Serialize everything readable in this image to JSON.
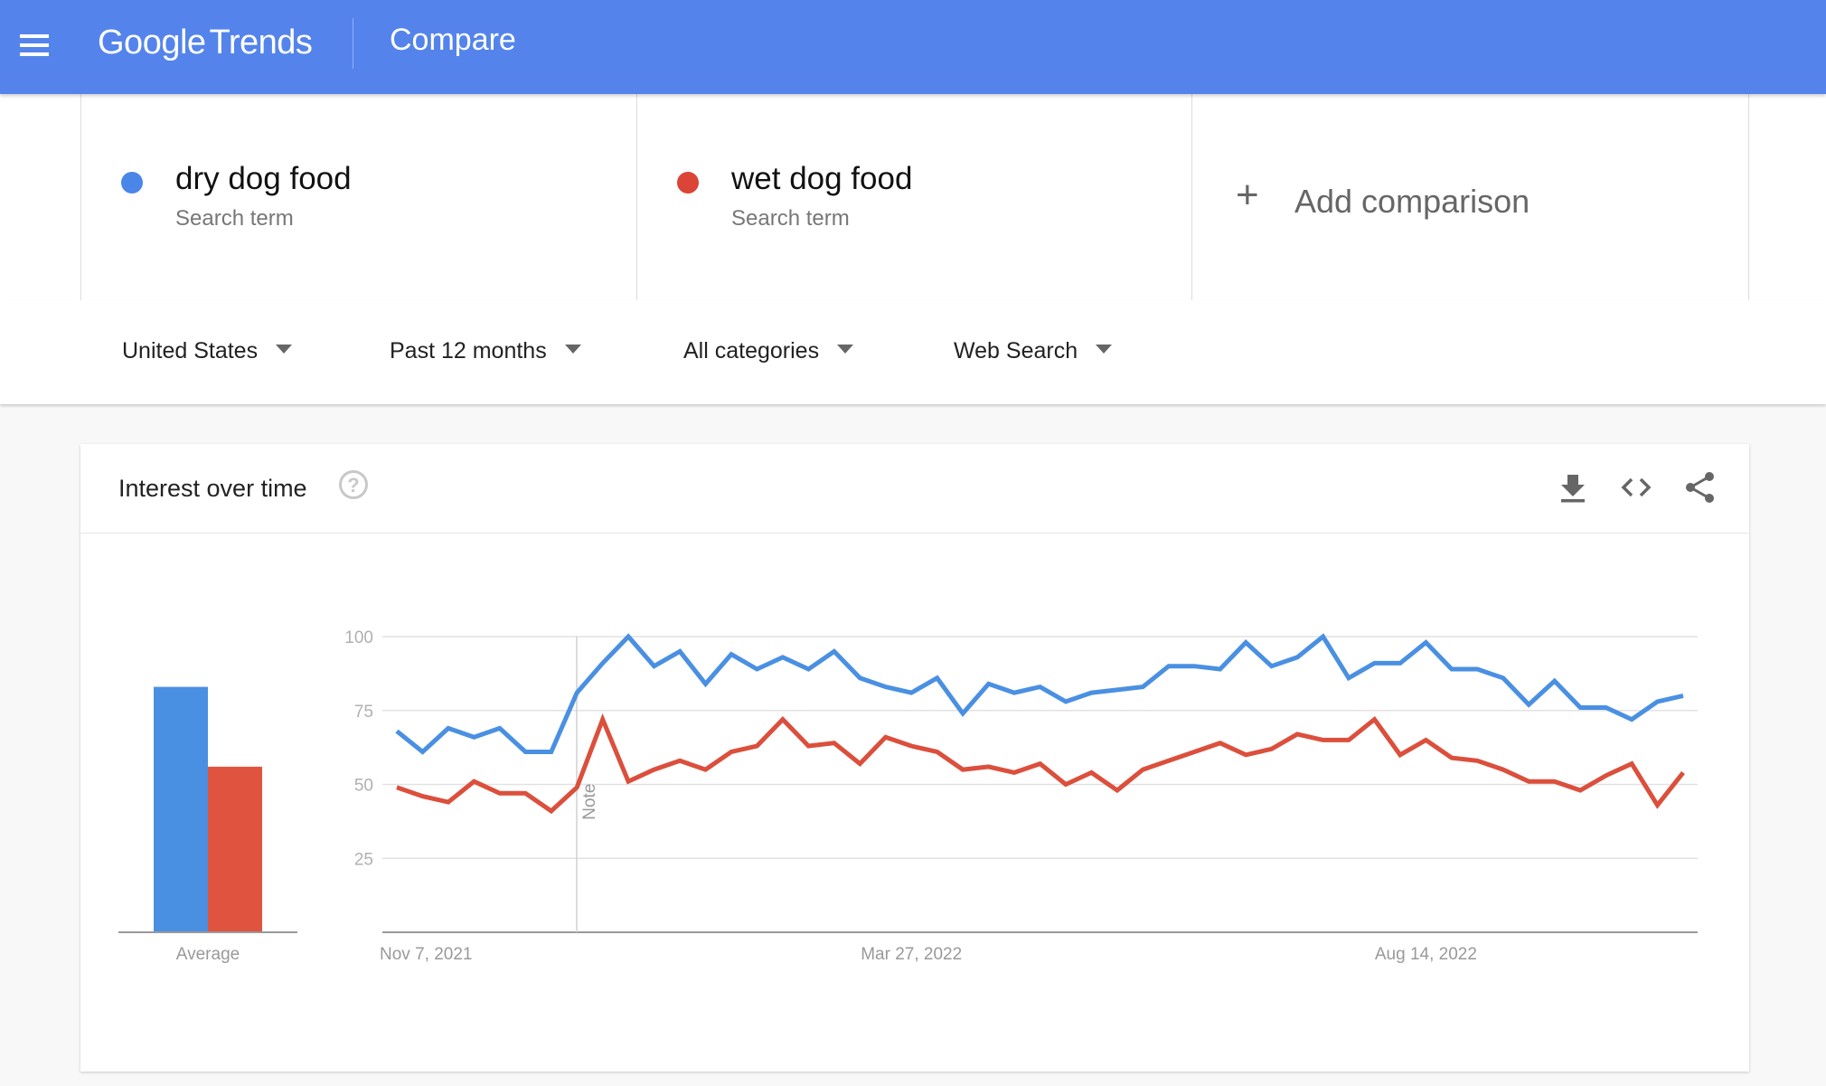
{
  "header": {
    "menu_icon": "hamburger-menu-icon",
    "logo_google": "Google",
    "logo_trends": "Trends",
    "page_title": "Compare"
  },
  "terms": [
    {
      "name": "dry dog food",
      "type": "Search term",
      "color": "#4a86e8"
    },
    {
      "name": "wet dog food",
      "type": "Search term",
      "color": "#db4437"
    }
  ],
  "add_comparison": {
    "icon": "plus-icon",
    "label": "Add comparison"
  },
  "filters": [
    {
      "label": "United States",
      "icon": "caret-down-icon"
    },
    {
      "label": "Past 12 months",
      "icon": "caret-down-icon"
    },
    {
      "label": "All categories",
      "icon": "caret-down-icon"
    },
    {
      "label": "Web Search",
      "icon": "caret-down-icon"
    }
  ],
  "card": {
    "title": "Interest over time",
    "help_glyph": "?",
    "tools": [
      "download-icon",
      "embed-code-icon",
      "share-icon"
    ]
  },
  "colors": {
    "blue": "#4a90e2",
    "red": "#db4f3c",
    "header": "#5484eb"
  },
  "chart_data": {
    "type": "line",
    "title": "Interest over time",
    "xlabel": "",
    "ylabel": "",
    "ylim": [
      0,
      100
    ],
    "yticks": [
      25,
      50,
      75,
      100
    ],
    "grid": true,
    "x_tick_labels": [
      {
        "index": 0,
        "label": "Nov 7, 2021"
      },
      {
        "index": 20,
        "label": "Mar 27, 2022"
      },
      {
        "index": 40,
        "label": "Aug 14, 2022"
      }
    ],
    "annotation": {
      "index": 7,
      "label": "Note"
    },
    "series": [
      {
        "name": "dry dog food",
        "color": "#4a90e2",
        "values": [
          68,
          61,
          69,
          66,
          69,
          61,
          61,
          81,
          91,
          100,
          90,
          95,
          84,
          94,
          89,
          93,
          89,
          95,
          86,
          83,
          81,
          86,
          74,
          84,
          81,
          83,
          78,
          81,
          82,
          83,
          90,
          90,
          89,
          98,
          90,
          93,
          100,
          86,
          91,
          91,
          98,
          89,
          89,
          86,
          77,
          85,
          76,
          76,
          72,
          78,
          80
        ]
      },
      {
        "name": "wet dog food",
        "color": "#db4f3c",
        "values": [
          49,
          46,
          44,
          51,
          47,
          47,
          41,
          49,
          72,
          51,
          55,
          58,
          55,
          61,
          63,
          72,
          63,
          64,
          57,
          66,
          63,
          61,
          55,
          56,
          54,
          57,
          50,
          54,
          48,
          55,
          58,
          61,
          64,
          60,
          62,
          67,
          65,
          65,
          72,
          60,
          65,
          59,
          58,
          55,
          51,
          51,
          48,
          53,
          57,
          43,
          54
        ]
      }
    ],
    "average": {
      "label": "Average",
      "values": [
        {
          "name": "dry dog food",
          "value": 83,
          "color": "#4a90e2"
        },
        {
          "name": "wet dog food",
          "value": 56,
          "color": "#e0533f"
        }
      ]
    }
  }
}
